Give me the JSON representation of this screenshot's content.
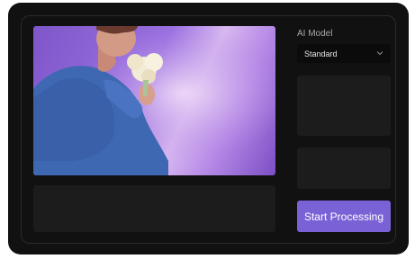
{
  "settings": {
    "ai_model_label": "AI Model",
    "ai_model_selected": "Standard",
    "start_button_label": "Start Processing"
  },
  "colors": {
    "device_background": "#111111",
    "panel_background": "#1c1c1c",
    "button_accent": "#7a62d6",
    "select_background": "#0b0b0b"
  },
  "icons": {
    "select_chevron": "chevron-down-icon"
  }
}
